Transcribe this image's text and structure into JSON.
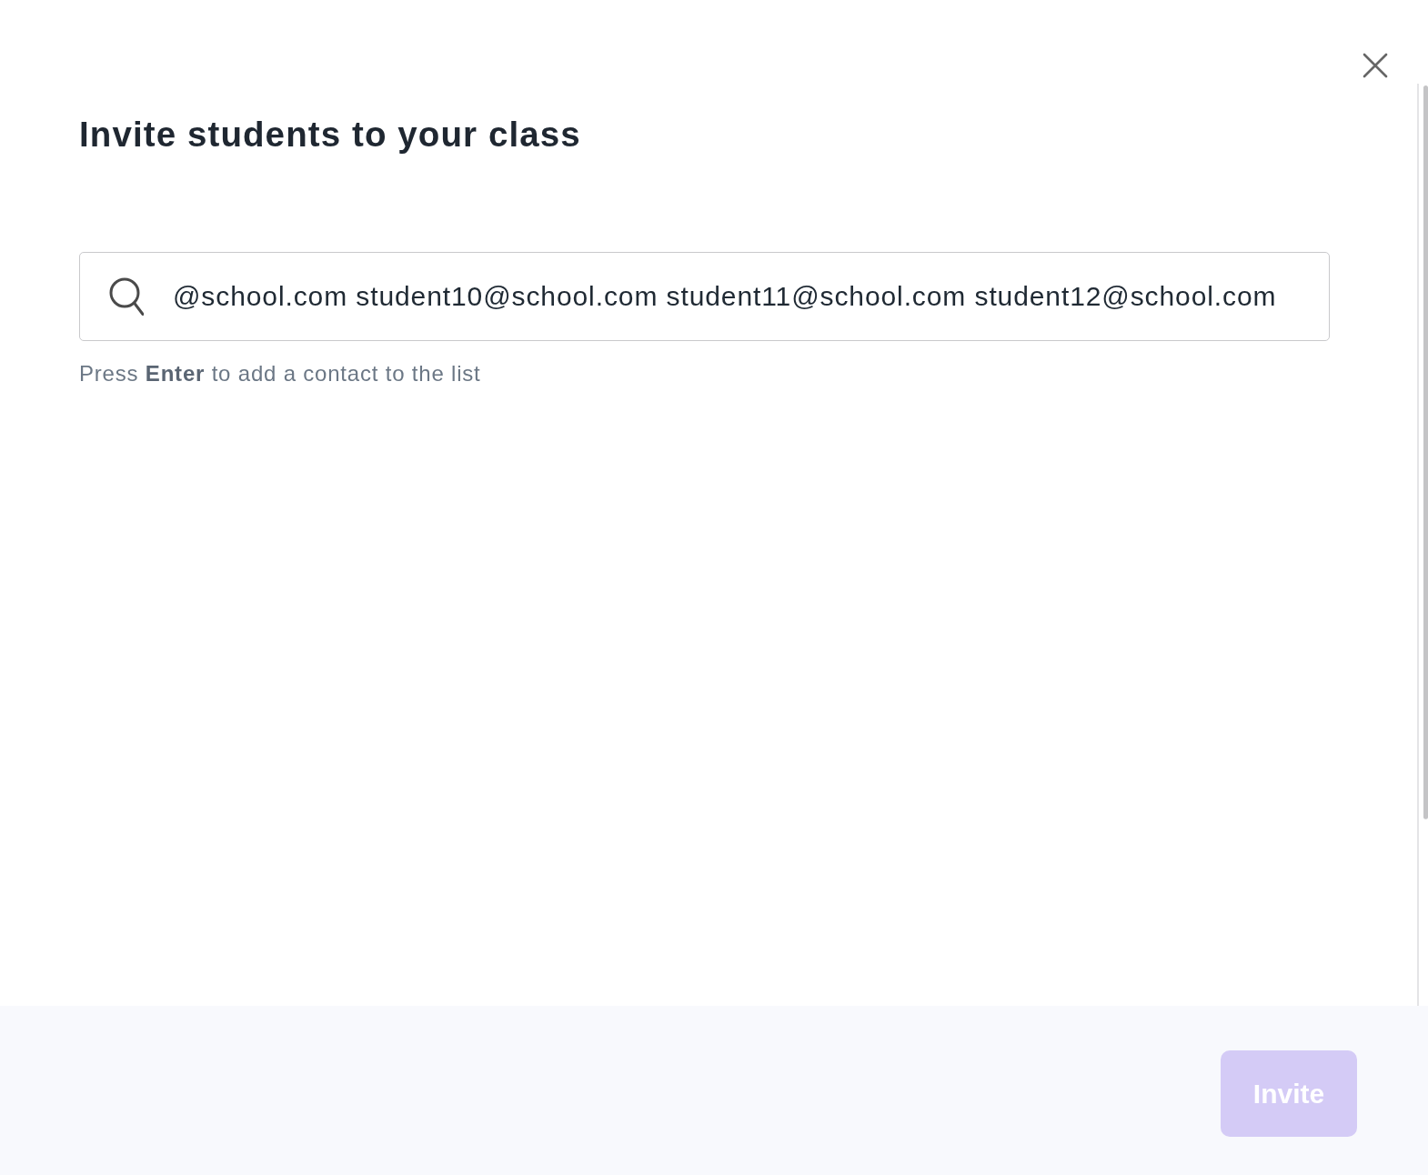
{
  "title": "Invite students to your class",
  "search_field": {
    "value": "@school.com student10@school.com student11@school.com student12@school.com"
  },
  "hint": "Press **Enter** to add a contact to the list",
  "footer": {
    "invite_button": {
      "label": "Invite",
      "disabled": true
    }
  }
}
